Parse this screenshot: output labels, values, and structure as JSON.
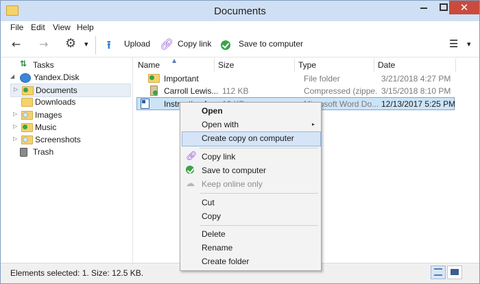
{
  "window": {
    "title": "Documents"
  },
  "window_controls": {
    "minimize": "–",
    "maximize": "□",
    "close": "✕"
  },
  "menu": [
    "File",
    "Edit",
    "View",
    "Help"
  ],
  "toolbar": {
    "back_icon": "←",
    "forward_icon": "→",
    "settings_icon": "⚙",
    "dropdown_icon": "▾",
    "upload_label": "Upload",
    "copy_link_label": "Copy link",
    "save_label": "Save to computer",
    "view_icon": "☰",
    "view_dropdown_icon": "▾"
  },
  "sidebar": {
    "items": [
      {
        "label": "Tasks"
      },
      {
        "label": "Yandex.Disk"
      },
      {
        "label": "Documents"
      },
      {
        "label": "Downloads"
      },
      {
        "label": "Images"
      },
      {
        "label": "Music"
      },
      {
        "label": "Screenshots"
      },
      {
        "label": "Trash"
      }
    ],
    "expanded_glyph": "◢",
    "collapsed_glyph": "▷"
  },
  "columns": {
    "name": "Name",
    "size": "Size",
    "type": "Type",
    "date": "Date",
    "sort_icon": "▲"
  },
  "files": [
    {
      "name": "Important",
      "size": "",
      "type": "File folder",
      "date": "3/21/2018 4:27 PM"
    },
    {
      "name": "Carroll Lewis...",
      "size": "112 KB",
      "type": "Compressed (zippe...",
      "date": "3/15/2018 8:10 PM"
    },
    {
      "name": "Instruction fo...",
      "size": "12 KB",
      "type": "Microsoft Word Do...",
      "date": "12/13/2017 5:25 PM"
    }
  ],
  "context_menu": {
    "open": "Open",
    "open_with": "Open with",
    "submenu_arrow": "▸",
    "create_copy": "Create copy on computer",
    "copy_link": "Copy link",
    "save_to_computer": "Save to computer",
    "keep_online": "Keep online only",
    "cut": "Cut",
    "copy": "Copy",
    "delete": "Delete",
    "rename": "Rename",
    "create_folder": "Create folder"
  },
  "status": {
    "text": "Elements selected: 1. Size: 12.5 KB."
  },
  "colors": {
    "accent": "#2e7ad1",
    "selection": "#cce4f7",
    "green": "#3aa34a",
    "folder": "#f5d36b",
    "close": "#c94b3e"
  }
}
